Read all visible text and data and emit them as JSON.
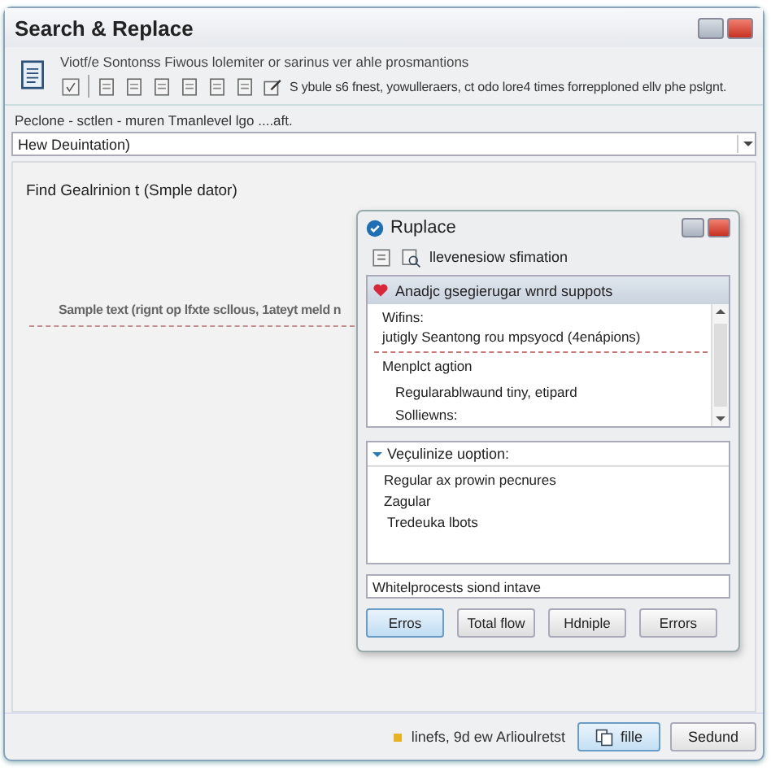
{
  "window": {
    "title": "Search & Replace"
  },
  "toolbar": {
    "description": "Viotf/e Sontonss Fiwous lolemiter or sarinus ver ahle prosmantions",
    "hint": "S ybule s6 fnest, yowulleraers, ct odo lore4 times forrepploned ellv phe pslgnt."
  },
  "combo": {
    "label": "Peclone - sctlen - muren  Tmanlevel lgo ....aft.",
    "value": "Hew Deuintation)"
  },
  "find_label": "Find Gealrinion t (Smple dator)",
  "sample_text": "Sample text (rignt op lfxte scllous, 1ateyt meld n",
  "dialog": {
    "title": "Ruplace",
    "toolbar_label": "llevenesiow sfimation",
    "group1": {
      "header": "Anadjc gsegierugar wnrd suppots",
      "lines": [
        {
          "kind": "text",
          "text": "Wifins:"
        },
        {
          "kind": "text",
          "text": "jutigly Seantong rou mpsyocd (4enápions)"
        },
        {
          "kind": "rule"
        },
        {
          "kind": "text",
          "text": "Menplct agtion"
        },
        {
          "kind": "indent",
          "text": "Regularablwaund tiny, etipard"
        },
        {
          "kind": "indent",
          "text": "Solliewns:"
        }
      ]
    },
    "group2": {
      "header": "Veçulinize uoption:",
      "items": [
        "Regular ax prowin pecnures",
        "Zagular",
        "Tredeuka lbots"
      ]
    },
    "input": {
      "value": "Whitelprocests siond intave"
    },
    "buttons": [
      {
        "label": "Erros",
        "default": true
      },
      {
        "label": "Total flow",
        "default": false
      },
      {
        "label": "Hdniple",
        "default": false
      },
      {
        "label": "Errors",
        "default": false
      }
    ]
  },
  "status_bar": {
    "text": "linefs, 9d ew Arlioulretst",
    "buttons": [
      {
        "label": "fille",
        "default": true,
        "icon": true
      },
      {
        "label": "Sedund",
        "default": false,
        "icon": false
      }
    ]
  }
}
